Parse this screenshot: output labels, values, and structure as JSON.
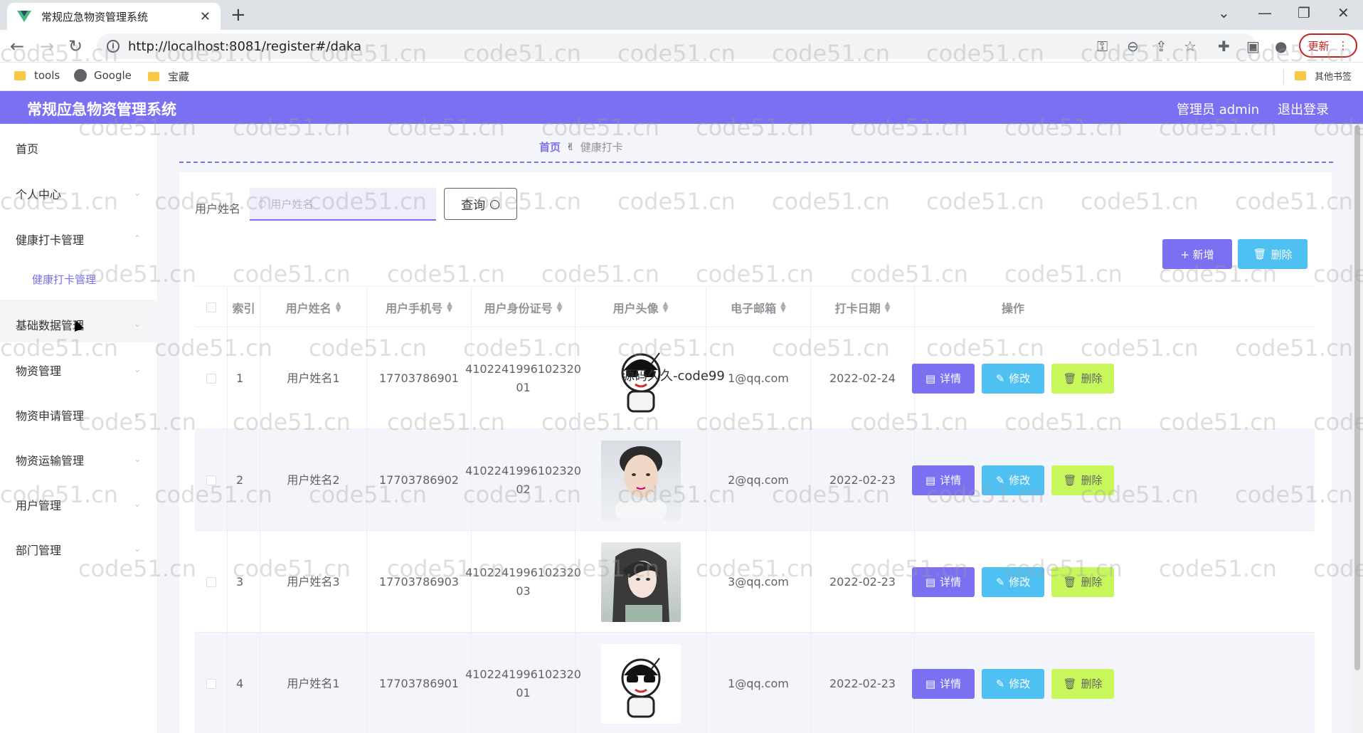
{
  "browser": {
    "tab_title": "常规应急物资管理系统",
    "url": "http://localhost:8081/register#/daka",
    "update_label": "更新",
    "bookmarks": [
      {
        "label": "tools",
        "icon": "folder-icon"
      },
      {
        "label": "Google",
        "icon": "globe-icon"
      },
      {
        "label": "宝藏",
        "icon": "folder-icon"
      }
    ],
    "other_bookmarks": "其他书签"
  },
  "header": {
    "title": "常规应急物资管理系统",
    "admin_label": "管理员 admin",
    "logout_label": "退出登录"
  },
  "sidebar": {
    "items": [
      {
        "label": "首页"
      },
      {
        "label": "个人中心"
      },
      {
        "label": "健康打卡管理"
      },
      {
        "label": "健康打卡管理"
      },
      {
        "label": "基础数据管理"
      },
      {
        "label": "物资管理"
      },
      {
        "label": "物资申请管理"
      },
      {
        "label": "物资运输管理"
      },
      {
        "label": "用户管理"
      },
      {
        "label": "部门管理"
      }
    ]
  },
  "breadcrumb": {
    "home": "首页",
    "current": "健康打卡"
  },
  "search": {
    "label": "用户姓名",
    "placeholder": "用户姓名",
    "query_label": "查询"
  },
  "actions": {
    "add_label": "+ 新增",
    "delete_label": "删除"
  },
  "table": {
    "headers": [
      "索引",
      "用户姓名",
      "用户手机号",
      "用户身份证号",
      "用户头像",
      "电子邮箱",
      "打卡日期",
      "操作"
    ],
    "row_actions": {
      "detail": "详情",
      "edit": "修改",
      "delete": "删除"
    },
    "rows": [
      {
        "index": "1",
        "name": "用户姓名1",
        "phone": "17703786901",
        "id_line1": "4102241996102320",
        "id_line2": "01",
        "avatar": "cartoon",
        "email": "1@qq.com",
        "date": "2022-02-24"
      },
      {
        "index": "2",
        "name": "用户姓名2",
        "phone": "17703786902",
        "id_line1": "4102241996102320",
        "id_line2": "02",
        "avatar": "boy",
        "email": "2@qq.com",
        "date": "2022-02-23"
      },
      {
        "index": "3",
        "name": "用户姓名3",
        "phone": "17703786903",
        "id_line1": "4102241996102320",
        "id_line2": "03",
        "avatar": "girl",
        "email": "3@qq.com",
        "date": "2022-02-23"
      },
      {
        "index": "4",
        "name": "用户姓名1",
        "phone": "17703786901",
        "id_line1": "4102241996102320",
        "id_line2": "01",
        "avatar": "cartoon",
        "email": "1@qq.com",
        "date": "2022-02-23"
      }
    ]
  },
  "overlay_text": "源码久久-code99",
  "watermark": "code51.cn",
  "colors": {
    "primary": "#7b6ff2",
    "info": "#4ec0f2",
    "danger_lime": "#c7f75a"
  }
}
